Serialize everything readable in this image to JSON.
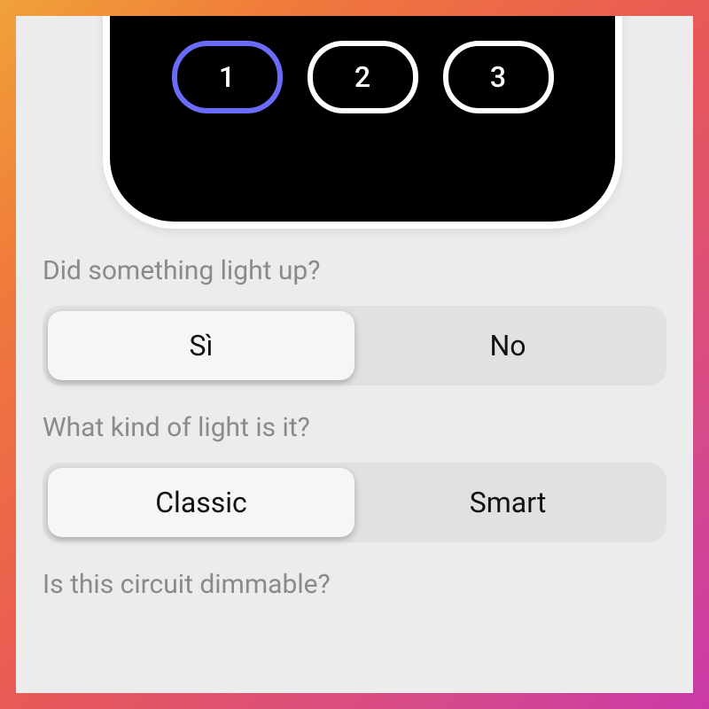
{
  "device": {
    "buttons": [
      "1",
      "2",
      "3"
    ],
    "activeIndex": 0
  },
  "questions": {
    "q1": {
      "label": "Did something light up?",
      "options": [
        "Sì",
        "No"
      ],
      "selectedIndex": 0
    },
    "q2": {
      "label": "What kind of light is it?",
      "options": [
        "Classic",
        "Smart"
      ],
      "selectedIndex": 0
    },
    "q3": {
      "label": "Is this circuit dimmable?"
    }
  }
}
